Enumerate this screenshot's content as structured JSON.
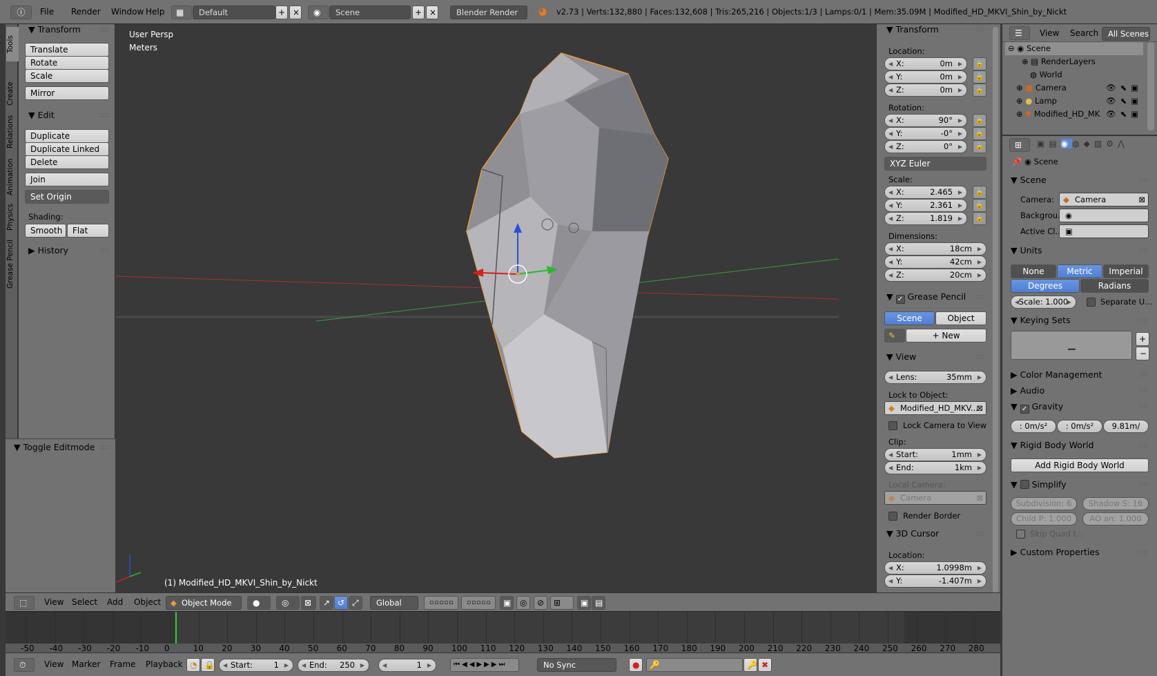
{
  "topbar": {
    "menus": [
      "File",
      "Render",
      "Window",
      "Help"
    ],
    "layout": "Default",
    "scene": "Scene",
    "engine": "Blender Render",
    "stats": "v2.73 | Verts:132,880 | Faces:132,608 | Tris:265,216 | Objects:1/3 | Lamps:0/1 | Mem:35.09M | Modified_HD_MKVI_Shin_by_Nickt"
  },
  "sidetabs": [
    "Tools",
    "Create",
    "Relations",
    "Animation",
    "Physics",
    "Grease Pencil"
  ],
  "tools": {
    "transform_header": "Transform",
    "translate": "Translate",
    "rotate": "Rotate",
    "scale": "Scale",
    "mirror": "Mirror",
    "edit_header": "Edit",
    "duplicate": "Duplicate",
    "duplicate_linked": "Duplicate Linked",
    "delete": "Delete",
    "join": "Join",
    "set_origin": "Set Origin",
    "shading": "Shading:",
    "smooth": "Smooth",
    "flat": "Flat",
    "history": "History",
    "toggle_editmode": "Toggle Editmode"
  },
  "viewport": {
    "persp": "User Persp",
    "units": "Meters",
    "object_label": "(1) Modified_HD_MKVI_Shin_by_Nickt"
  },
  "npanel": {
    "transform": "Transform",
    "location": "Location:",
    "loc": [
      {
        "a": "X:",
        "v": "0m"
      },
      {
        "a": "Y:",
        "v": "0m"
      },
      {
        "a": "Z:",
        "v": "0m"
      }
    ],
    "rotation": "Rotation:",
    "rot": [
      {
        "a": "X:",
        "v": "90°"
      },
      {
        "a": "Y:",
        "v": "-0°"
      },
      {
        "a": "Z:",
        "v": "0°"
      }
    ],
    "euler": "XYZ Euler",
    "scale": "Scale:",
    "scl": [
      {
        "a": "X:",
        "v": "2.465"
      },
      {
        "a": "Y:",
        "v": "2.361"
      },
      {
        "a": "Z:",
        "v": "1.819"
      }
    ],
    "dimensions": "Dimensions:",
    "dim": [
      {
        "a": "X:",
        "v": "18cm"
      },
      {
        "a": "Y:",
        "v": "42cm"
      },
      {
        "a": "Z:",
        "v": "20cm"
      }
    ],
    "grease_pencil": "Grease Pencil",
    "scene_btn": "Scene",
    "object_btn": "Object",
    "new_btn": "New",
    "view": "View",
    "lens_label": "Lens:",
    "lens": "35mm",
    "lock_to_object": "Lock to Object:",
    "lock_object": "Modified_HD_MKV...",
    "lock_camera": "Lock Camera to View",
    "clip": "Clip:",
    "start_label": "Start:",
    "start": "1mm",
    "end_label": "End:",
    "end": "1km",
    "local_camera": "Local Camera:",
    "camera": "Camera",
    "render_border": "Render Border",
    "cursor": "3D Cursor",
    "cursor_location": "Location:",
    "cur": [
      {
        "a": "X:",
        "v": "1.0998m"
      },
      {
        "a": "Y:",
        "v": "-1.407m"
      }
    ]
  },
  "outliner": {
    "view": "View",
    "search": "Search",
    "all_scenes": "All Scenes",
    "items": [
      "Scene",
      "RenderLayers",
      "World",
      "Camera",
      "Lamp",
      "Modified_HD_MK"
    ]
  },
  "props": {
    "scene_path": "Scene",
    "scene_header": "Scene",
    "camera_label": "Camera:",
    "camera": "Camera",
    "background_label": "Backgrou...",
    "active_clip_label": "Active Cl...",
    "units": "Units",
    "none": "None",
    "metric": "Metric",
    "imperial": "Imperial",
    "degrees": "Degrees",
    "radians": "Radians",
    "scale": "Scale: 1.000",
    "separate": "Separate U...",
    "keying_sets": "Keying Sets",
    "color_management": "Color Management",
    "audio": "Audio",
    "gravity": "Gravity",
    "gx": ": 0m/s²",
    "gy": ": 0m/s²",
    "gz": "9.81m/",
    "rigid_body": "Rigid Body World",
    "add_rigid": "Add Rigid Body World",
    "simplify": "Simplify",
    "subdivision": "Subdivision: 6",
    "shadow": "Shadow S: 16",
    "child": "Child P: 1.000",
    "ao": "AO an: 1.000",
    "skip_quad": "Skip Quad t...",
    "custom_props": "Custom Properties"
  },
  "viewheader": {
    "view": "View",
    "select": "Select",
    "add": "Add",
    "object": "Object",
    "mode": "Object Mode",
    "orientation": "Global"
  },
  "timeline": {
    "ticks": [
      "-50",
      "-40",
      "-30",
      "-20",
      "-10",
      "0",
      "10",
      "20",
      "30",
      "40",
      "50",
      "60",
      "70",
      "80",
      "90",
      "100",
      "110",
      "120",
      "130",
      "140",
      "150",
      "160",
      "170",
      "180",
      "190",
      "200",
      "210",
      "220",
      "230",
      "240",
      "250",
      "260",
      "270",
      "280"
    ],
    "current_frame_pos": 0,
    "view": "View",
    "marker": "Marker",
    "frame": "Frame",
    "playback": "Playback",
    "start_label": "Start:",
    "start": "1",
    "end_label": "End:",
    "end": "250",
    "current": "1",
    "sync": "No Sync"
  },
  "colors": {
    "selection": "#e89b3a",
    "x_axis": "#d42020",
    "y_axis": "#2bb82b",
    "z_axis": "#2a4fd8",
    "frame_marker": "#33cc33"
  }
}
